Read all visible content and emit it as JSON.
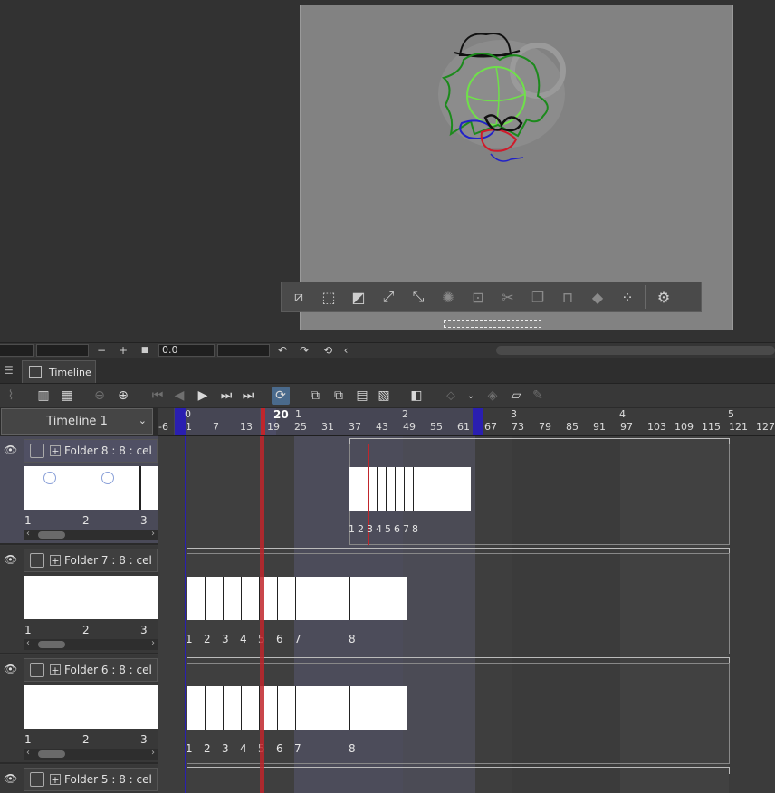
{
  "status_bar": {
    "zoom_minus": "−",
    "zoom_plus": "+",
    "rotation_value": "0.0"
  },
  "tab": {
    "title": "Timeline"
  },
  "timeline_select": {
    "value": "Timeline 1"
  },
  "ruler": {
    "current_frame": "20",
    "second_labels": [
      "0",
      "1",
      "2",
      "3",
      "4",
      "5"
    ],
    "frame_ticks": [
      "-6",
      "1",
      "7",
      "13",
      "19",
      "25",
      "31",
      "37",
      "43",
      "49",
      "55",
      "61",
      "67",
      "73",
      "79",
      "85",
      "91",
      "97",
      "103",
      "109",
      "115",
      "121",
      "127"
    ]
  },
  "layers": [
    {
      "name": "Folder 8 : 8 : cel",
      "selected": true,
      "thumb_labels": [
        "1",
        "2",
        "3"
      ],
      "cels": [
        "1",
        "2",
        "3",
        "4",
        "5",
        "6",
        "7",
        "8"
      ]
    },
    {
      "name": "Folder 7 : 8 : cel",
      "selected": false,
      "thumb_labels": [
        "1",
        "2",
        "3"
      ],
      "cels": [
        "1",
        "2",
        "3",
        "4",
        "5",
        "6",
        "7",
        "8"
      ]
    },
    {
      "name": "Folder 6 : 8 : cel",
      "selected": false,
      "thumb_labels": [
        "1",
        "2",
        "3"
      ],
      "cels": [
        "1",
        "2",
        "3",
        "4",
        "5",
        "6",
        "7",
        "8"
      ]
    },
    {
      "name": "Folder 5 : 8 : cel",
      "selected": false,
      "thumb_labels": [],
      "cels": []
    }
  ],
  "colors": {
    "playhead": "#c0262c",
    "range_marker": "#2a1fb0",
    "selection_highlight": "#55588a"
  }
}
